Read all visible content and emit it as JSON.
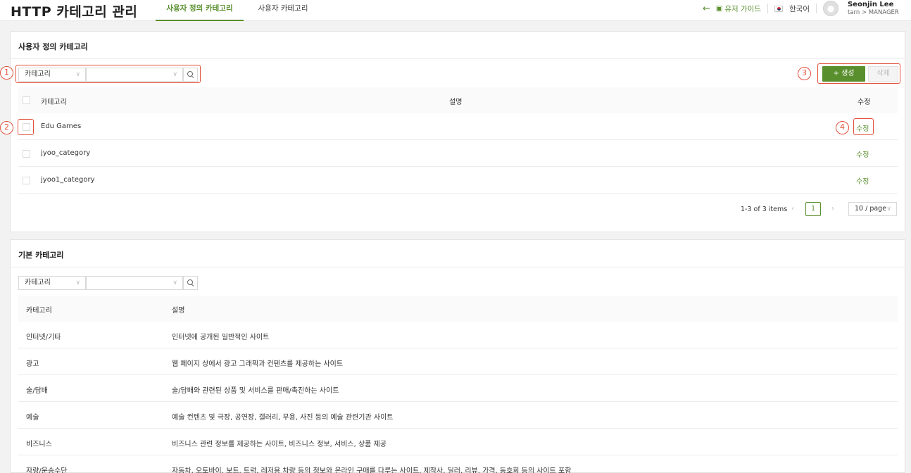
{
  "header": {
    "app_title": "HTTP 카테고리 관리",
    "tabs": [
      {
        "label": "사용자 정의 카테고리",
        "active": true
      },
      {
        "label": "사용자 카테고리",
        "active": false
      }
    ],
    "user_guide": "유저 가이드",
    "language": "한국어",
    "user_name": "Seonjin Lee",
    "user_tenant": "tarn",
    "user_role": "MANAGER",
    "role_separator": ">"
  },
  "custom_panel": {
    "title": "사용자 정의 카테고리",
    "filter_select": "카테고리",
    "search_value": "",
    "create_label": "+ 생성",
    "delete_label": "삭제",
    "columns": [
      "카테고리",
      "설명",
      "수정"
    ],
    "rows": [
      {
        "category": "Edu Games",
        "description": "",
        "edit": "수정"
      },
      {
        "category": "jyoo_category",
        "description": "",
        "edit": "수정"
      },
      {
        "category": "jyoo1_category",
        "description": "",
        "edit": "수정"
      }
    ],
    "pagination": {
      "summary": "1-3 of 3 items",
      "current_page": "1",
      "page_size": "10 / page"
    }
  },
  "base_panel": {
    "title": "기본 카테고리",
    "filter_select": "카테고리",
    "search_value": "",
    "columns": [
      "카테고리",
      "설명"
    ],
    "rows": [
      {
        "category": "인터넷/기타",
        "description": "인터넷에 공개된 일반적인 사이트"
      },
      {
        "category": "광고",
        "description": "웹 페이지 상에서 광고 그래픽과 컨텐츠를 제공하는 사이트"
      },
      {
        "category": "술/담배",
        "description": "술/담배와 관련된 상품 및 서비스를 판매/촉진하는 사이트"
      },
      {
        "category": "예술",
        "description": "예술 컨텐츠 및 극장, 공연장, 갤러리, 무용, 사진 등의 예술 관련기관 사이트"
      },
      {
        "category": "비즈니스",
        "description": "비즈니스 관련 정보를 제공하는 사이트, 비즈니스 정보, 서비스, 상품 제공"
      },
      {
        "category": "자량/운송수단",
        "description": "자동차, 오토바이, 보트, 트럭, 레저용 차량 등의 정보와 온라인 구매를 다루는 사이트, 제작사, 딜러, 리뷰, 가격, 동호회 등의 사이트 포함"
      }
    ]
  },
  "annotations": {
    "m1": "1",
    "m2": "2",
    "m3": "3",
    "m4": "4"
  },
  "colors": {
    "accent": "#5a8f2e",
    "annotation": "#e2503a"
  }
}
